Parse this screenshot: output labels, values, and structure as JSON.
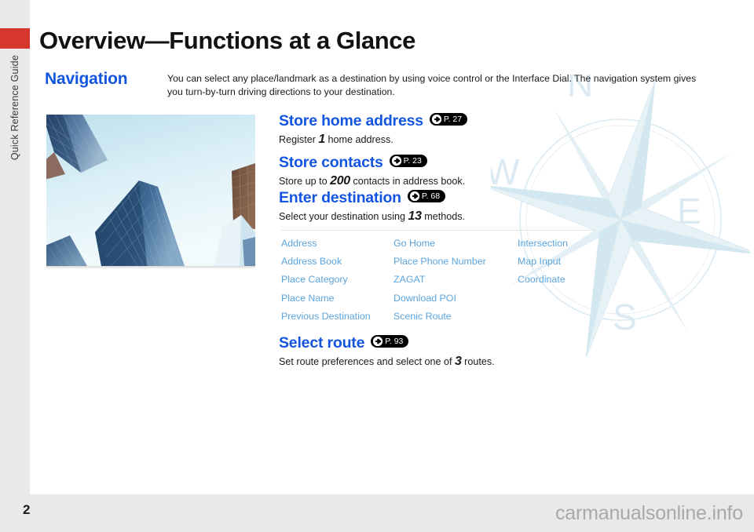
{
  "sidebar": {
    "label": "Quick Reference Guide",
    "accent_color": "#d7362e",
    "background": "#e9e9e9"
  },
  "footer": {
    "page_number": "2",
    "watermark": "carmanualsonline.info"
  },
  "header": {
    "title": "Overview—Functions at a Glance",
    "section": "Navigation",
    "section_color": "#1355e0",
    "intro": "You can select any place/landmark as a destination by using voice control or the Interface Dial. The navigation system gives you turn-by-turn driving directions to your destination."
  },
  "photo": {
    "alt": "Skyscrapers viewed from below against a pale blue sky"
  },
  "compass": {
    "north": "N",
    "west": "W",
    "east": "E",
    "south": "S",
    "color": "#dbeaf2"
  },
  "features": [
    {
      "heading": "Store home address",
      "page_ref": "P. 27",
      "desc_before": "Register ",
      "desc_number": "1",
      "desc_after": " home address."
    },
    {
      "heading": "Store contacts",
      "page_ref": "P. 23",
      "desc_before": "Store up to ",
      "desc_number": "200",
      "desc_after": " contacts in address book."
    },
    {
      "heading": "Enter destination",
      "page_ref": "P. 68",
      "desc_before": "Select your destination using ",
      "desc_number": "13",
      "desc_after": " methods."
    },
    {
      "heading": "Select route",
      "page_ref": "P. 93",
      "desc_before": "Set route preferences and select one of ",
      "desc_number": "3",
      "desc_after": " routes."
    }
  ],
  "destination_methods": {
    "link_color": "#5ba4dd",
    "columns": [
      [
        "Address",
        "Address Book",
        "Place Category",
        "Place Name",
        "Previous Destination"
      ],
      [
        "Go Home",
        "Place Phone Number",
        "ZAGAT",
        "Download POI",
        "Scenic Route"
      ],
      [
        "Intersection",
        "Map Input",
        "Coordinate",
        "",
        ""
      ]
    ]
  }
}
